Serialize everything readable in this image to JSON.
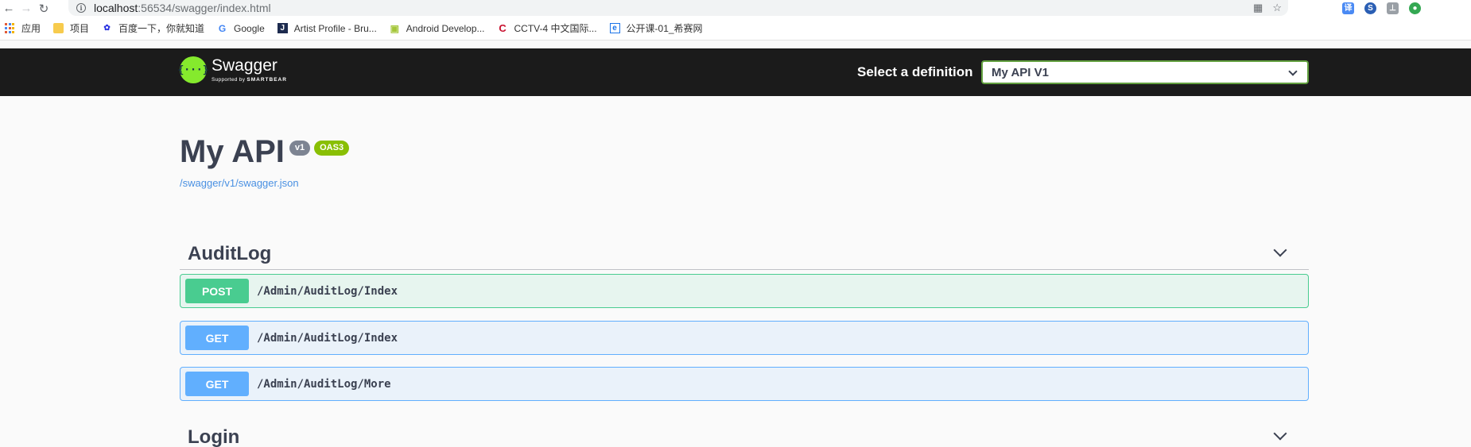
{
  "browser": {
    "url_host": "localhost",
    "url_rest": ":56534/swagger/index.html",
    "bookmarks": [
      {
        "label": "应用",
        "icon": "apps-grid-icon"
      },
      {
        "label": "项目",
        "icon": "folder-icon"
      },
      {
        "label": "百度一下，你就知道",
        "icon": "baidu-paw-icon"
      },
      {
        "label": "Google",
        "icon": "google-g-icon"
      },
      {
        "label": "Artist Profile - Bru...",
        "icon": "j-square-icon"
      },
      {
        "label": "Android Develop...",
        "icon": "android-robot-icon"
      },
      {
        "label": "CCTV-4 中文国际...",
        "icon": "cctv-c-icon"
      },
      {
        "label": "公开课-01_希赛网",
        "icon": "e-square-icon"
      }
    ]
  },
  "topbar": {
    "logo_word": "Swagger",
    "logo_sub_prefix": "Supported by",
    "logo_sub_brand": "SMARTBEAR",
    "definition_label": "Select a definition",
    "definition_selected": "My API V1"
  },
  "info": {
    "title": "My API",
    "version_badge": "v1",
    "oas_badge": "OAS3",
    "spec_url": "/swagger/v1/swagger.json"
  },
  "tags": [
    {
      "name": "AuditLog",
      "operations": [
        {
          "method": "POST",
          "path": "/Admin/AuditLog/Index"
        },
        {
          "method": "GET",
          "path": "/Admin/AuditLog/Index"
        },
        {
          "method": "GET",
          "path": "/Admin/AuditLog/More"
        }
      ]
    },
    {
      "name": "Login",
      "operations": []
    }
  ],
  "colors": {
    "post": "#49cc90",
    "get": "#61affe",
    "topbar": "#1b1b1b",
    "accent_green": "#85ea2d"
  }
}
